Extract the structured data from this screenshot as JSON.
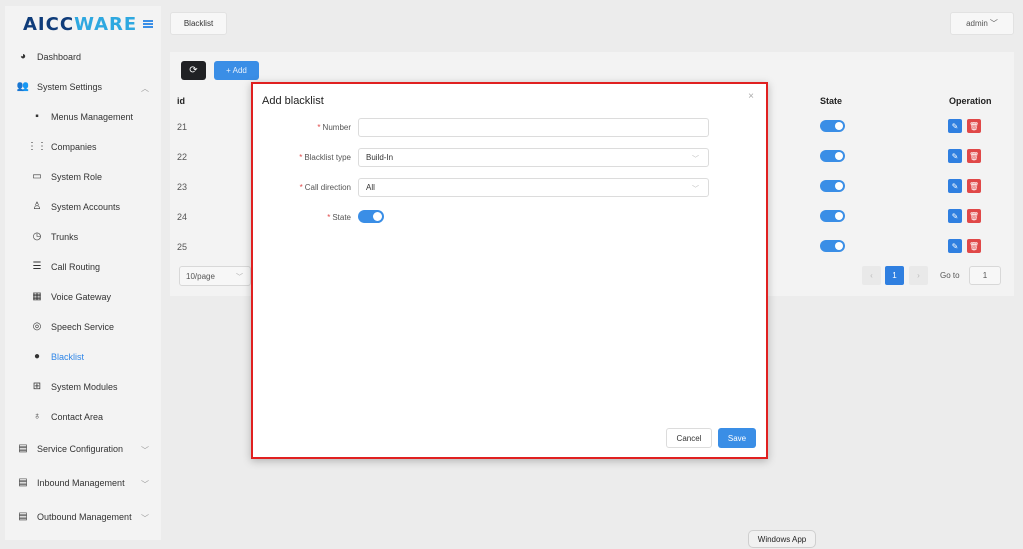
{
  "app": {
    "logo_part1": "AICC",
    "logo_part2": "WARE"
  },
  "sidebar": {
    "items": [
      {
        "label": "Dashboard",
        "icon": "dashboard-icon"
      },
      {
        "label": "System Settings",
        "icon": "users-group-icon"
      },
      {
        "label": "Menus Management",
        "icon": "grid-icon"
      },
      {
        "label": "Companies",
        "icon": "apps-icon"
      },
      {
        "label": "System Role",
        "icon": "id-card-icon"
      },
      {
        "label": "System Accounts",
        "icon": "user-icon"
      },
      {
        "label": "Trunks",
        "icon": "clock-icon"
      },
      {
        "label": "Call Routing",
        "icon": "list-icon"
      },
      {
        "label": "Voice Gateway",
        "icon": "calendar-icon"
      },
      {
        "label": "Speech Service",
        "icon": "globe-icon"
      },
      {
        "label": "Blacklist",
        "icon": "user-solid-icon"
      },
      {
        "label": "System Modules",
        "icon": "table-icon"
      },
      {
        "label": "Contact Area",
        "icon": "location-icon"
      },
      {
        "label": "Service Configuration",
        "icon": "credit-card-icon"
      },
      {
        "label": "Inbound Management",
        "icon": "inbound-icon"
      },
      {
        "label": "Outbound Management",
        "icon": "outbound-icon"
      }
    ]
  },
  "header": {
    "tab_label": "Blacklist",
    "user_label": "admin"
  },
  "toolbar": {
    "refresh_glyph": "⟳",
    "add_label": "+ Add"
  },
  "table": {
    "columns": {
      "id": "id",
      "state": "State",
      "operation": "Operation"
    },
    "rows": [
      {
        "id": "21",
        "state": "on"
      },
      {
        "id": "22",
        "state": "on"
      },
      {
        "id": "23",
        "state": "on"
      },
      {
        "id": "24",
        "state": "on"
      },
      {
        "id": "25",
        "state": "on"
      }
    ]
  },
  "pagination": {
    "page_size": "10/page",
    "current_page": "1",
    "goto_label": "Go to",
    "goto_value": "1"
  },
  "modal": {
    "title": "Add blacklist",
    "close_glyph": "×",
    "fields": {
      "number_label": "Number",
      "number_value": "",
      "type_label": "Blacklist type",
      "type_value": "Build-In",
      "direction_label": "Call direction",
      "direction_value": "All",
      "state_label": "State"
    },
    "cancel_label": "Cancel",
    "save_label": "Save"
  },
  "os": {
    "tooltip": "Windows App"
  },
  "colors": {
    "accent": "#3a8ee6",
    "danger": "#e04848",
    "highlight_border": "#e02020"
  }
}
